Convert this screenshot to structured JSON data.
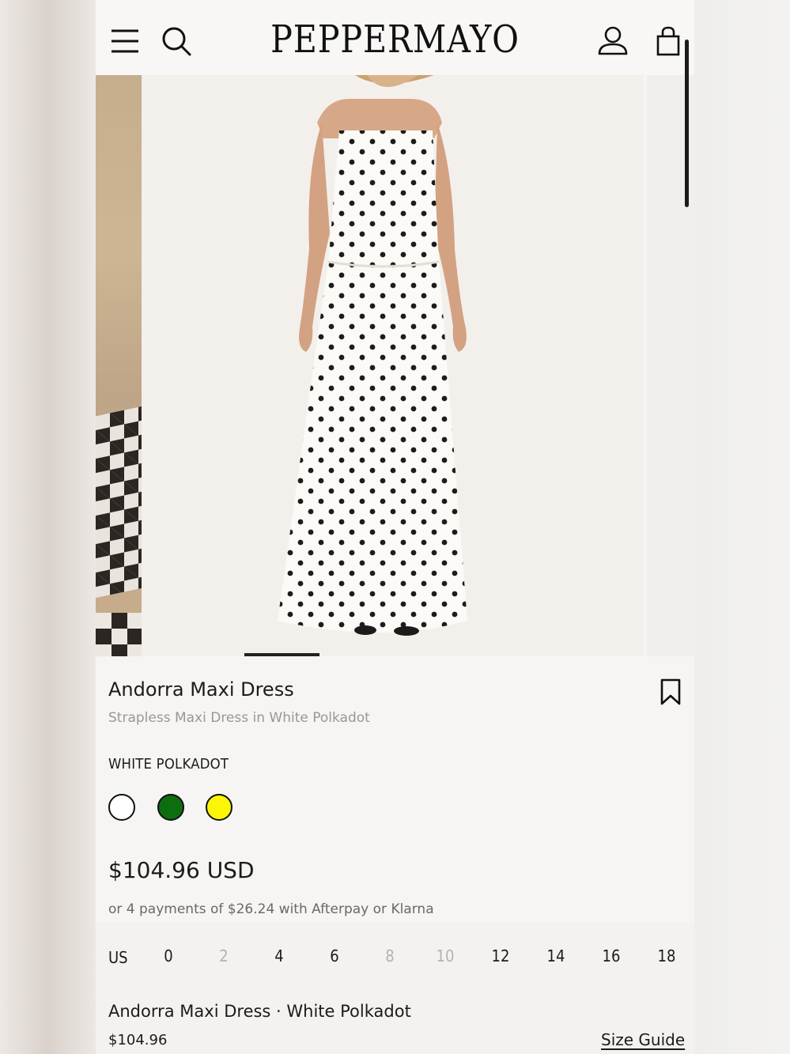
{
  "header": {
    "brand": "PEPPERMAYO",
    "icons": [
      "menu-icon",
      "search-icon",
      "account-icon",
      "bag-icon"
    ]
  },
  "gallery": {
    "current_slide_fraction": 0.13
  },
  "product": {
    "name": "Andorra Maxi Dress",
    "subtitle": "Strapless Maxi Dress in White Polkadot",
    "color_label": "WHITE POLKADOT",
    "swatches": [
      {
        "name": "white",
        "color": "#ffffff"
      },
      {
        "name": "green",
        "color": "#0d6e10"
      },
      {
        "name": "yellow",
        "color": "#fbf507"
      }
    ],
    "price": "$104.96 USD",
    "installments": "or 4 payments of $26.24 with Afterpay or Klarna"
  },
  "sizes": {
    "unit": "US",
    "options": [
      {
        "label": "0",
        "available": true
      },
      {
        "label": "2",
        "available": false
      },
      {
        "label": "4",
        "available": true
      },
      {
        "label": "6",
        "available": true
      },
      {
        "label": "8",
        "available": false
      },
      {
        "label": "10",
        "available": false
      },
      {
        "label": "12",
        "available": true
      },
      {
        "label": "14",
        "available": true
      },
      {
        "label": "16",
        "available": true
      },
      {
        "label": "18",
        "available": true
      }
    ]
  },
  "sticky_bar": {
    "title": "Andorra Maxi Dress · White Polkadot",
    "price": "$104.96",
    "size_guide": "Size Guide"
  },
  "colors": {
    "text": "#1b1b1b",
    "muted": "#9a9794",
    "unavailable": "#b5b2af"
  }
}
